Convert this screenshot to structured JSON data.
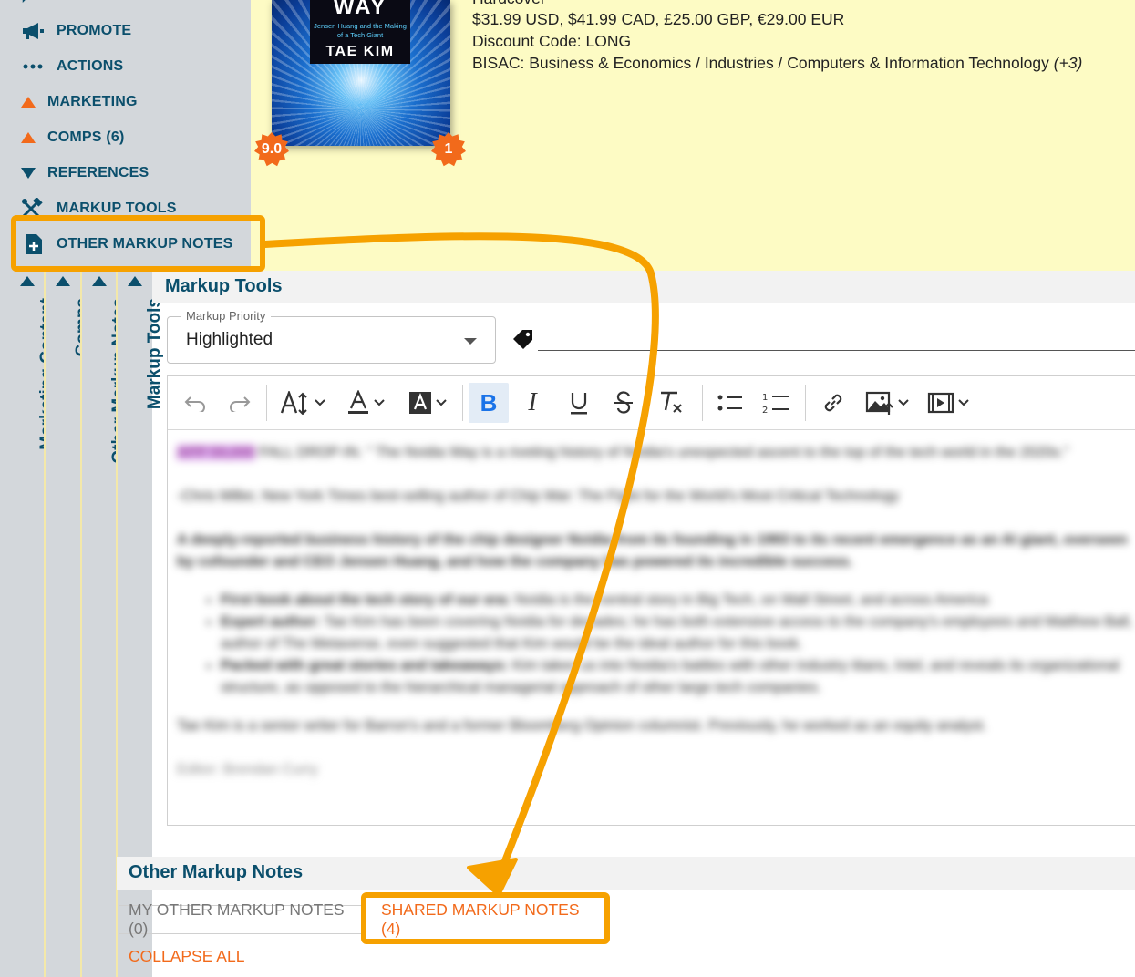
{
  "nav": {
    "items": [
      {
        "label": "PROMOTE",
        "icon": "megaphone-icon"
      },
      {
        "label": "ACTIONS",
        "icon": "more-dots-icon"
      },
      {
        "label": "MARKETING",
        "icon": "triangle-up-icon"
      },
      {
        "label": "COMPS (6)",
        "icon": "triangle-up-icon"
      },
      {
        "label": "REFERENCES",
        "icon": "triangle-down-icon"
      },
      {
        "label": "MARKUP TOOLS",
        "icon": "tools-icon"
      },
      {
        "label": "OTHER MARKUP NOTES",
        "icon": "add-note-icon"
      }
    ]
  },
  "vertical_tabs": [
    "Marketing Content",
    "Comps",
    "Other Markup Notes",
    "Markup Tools"
  ],
  "book": {
    "cover": {
      "title": "WAY",
      "subtitle": "Jensen Huang and the Making of a Tech Giant",
      "author": "TAE KIM"
    },
    "score_badge": "9.0",
    "count_badge": "1",
    "format": "Hardcover",
    "prices": "$31.99 USD, $41.99 CAD, £25.00 GBP, €29.00 EUR",
    "discount": "Discount Code: LONG",
    "bisac": "BISAC: Business & Economics / Industries / Computers & Information Technology",
    "bisac_extra": "(+3)"
  },
  "markup_tools": {
    "title": "Markup Tools",
    "priority_label": "Markup Priority",
    "priority_value": "Highlighted",
    "tag_value": ""
  },
  "editor": {
    "toolbar": [
      "undo-icon",
      "redo-icon",
      "font-size-icon",
      "font-color-icon",
      "highlight-color-icon",
      "bold-icon",
      "italic-icon",
      "underline-icon",
      "strikethrough-icon",
      "clear-format-icon",
      "bullet-list-icon",
      "numbered-list-icon",
      "link-icon",
      "insert-image-icon",
      "insert-video-icon"
    ],
    "highlight_tag": "APP 50,000",
    "intro": "FALL DROP-IN. \" The Nvidia Way is a riveting history of Nvidia's unexpected ascent to the top of the tech world in the 2020s.\"",
    "quote_attr": "-Chris Miller, New York Times best-selling author of Chip War: The Fight for the World's Most Critical Technology",
    "summary": "A deeply-reported business history of the chip designer Nvidia from its founding in 1993 to its recent emergence as an AI giant, overseen by cofounder and CEO Jensen Huang, and how the company has powered its incredible success.",
    "bullets": [
      {
        "lead": "First book about the tech story of our era:",
        "text": "Nvidia is the central story in Big Tech, on Wall Street, and across America"
      },
      {
        "lead": "Expert author:",
        "text": "Tae Kim has been covering Nvidia for decades; he has both extensive access to the company's employees and Matthew Ball, author of The Metaverse, even suggested that Kim would be the ideal author for this book."
      },
      {
        "lead": "Packed with great stories and takeaways:",
        "text": "Kim takes us into Nvidia's battles with other industry titans, Intel, and reveals its organizational structure, as opposed to the hierarchical managerial approach of other large tech companies."
      }
    ],
    "author_bio": "Tae Kim is a senior writer for Barron's and a former Bloomberg Opinion columnist. Previously, he worked as an equity analyst.",
    "editor_line": "Editor: Brendan Curry"
  },
  "other_notes": {
    "title": "Other Markup Notes",
    "tab_mine": "MY OTHER MARKUP NOTES (0)",
    "tab_shared": "SHARED MARKUP NOTES (4)",
    "collapse": "COLLAPSE ALL"
  },
  "colors": {
    "accent_orange": "#f26a1b",
    "annotation_orange": "#f6a100",
    "nav_text": "#0b4f6c",
    "top_panel_bg": "#fdfbc4",
    "nav_bg": "#d3d7db"
  }
}
